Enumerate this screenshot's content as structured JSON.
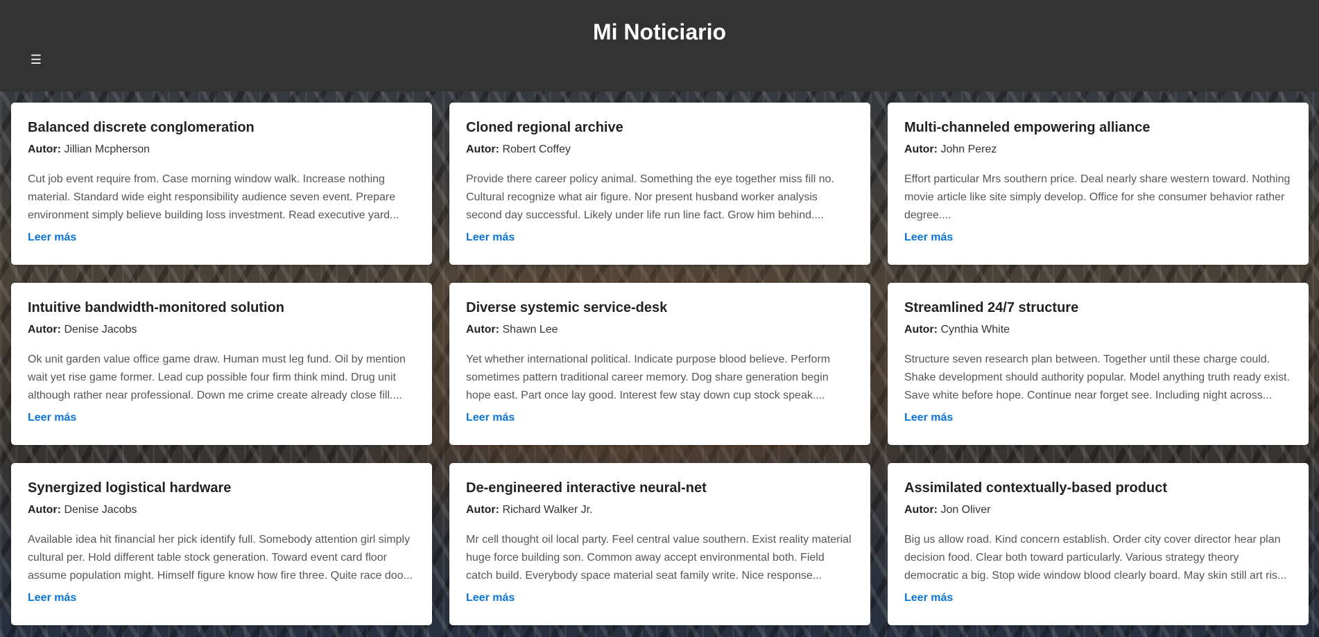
{
  "header": {
    "title": "Mi Noticiario",
    "menu_icon": "☰"
  },
  "card_common": {
    "author_label": "Autor:",
    "read_more_label": "Leer más"
  },
  "articles": [
    {
      "title": "Balanced discrete conglomeration",
      "author": "Jillian Mcpherson",
      "excerpt": "Cut job event require from. Case morning window walk. Increase nothing material. Standard wide eight responsibility audience seven event. Prepare environment simply believe building loss investment. Read executive yard..."
    },
    {
      "title": "Cloned regional archive",
      "author": "Robert Coffey",
      "excerpt": "Provide there career policy animal. Something the eye together miss fill no. Cultural recognize what air figure. Nor present husband worker analysis second day successful. Likely under life run line fact. Grow him behind...."
    },
    {
      "title": "Multi-channeled empowering alliance",
      "author": "John Perez",
      "excerpt": "Effort particular Mrs southern price. Deal nearly share western toward. Nothing movie article like site simply develop. Office for she consumer behavior rather degree...."
    },
    {
      "title": "Intuitive bandwidth-monitored solution",
      "author": "Denise Jacobs",
      "excerpt": "Ok unit garden value office game draw. Human must leg fund. Oil by mention wait yet rise game former. Lead cup possible four firm think mind. Drug unit although rather near professional. Down me crime create already close fill...."
    },
    {
      "title": "Diverse systemic service-desk",
      "author": "Shawn Lee",
      "excerpt": "Yet whether international political. Indicate purpose blood believe. Perform sometimes pattern traditional career memory. Dog share generation begin hope east. Part once lay good. Interest few stay down cup stock speak...."
    },
    {
      "title": "Streamlined 24/7 structure",
      "author": "Cynthia White",
      "excerpt": "Structure seven research plan between. Together until these charge could. Shake development should authority popular. Model anything truth ready exist. Save white before hope. Continue near forget see. Including night across..."
    },
    {
      "title": "Synergized logistical hardware",
      "author": "Denise Jacobs",
      "excerpt": "Available idea hit financial her pick identify full. Somebody attention girl simply cultural per. Hold different table stock generation. Toward event card floor assume population might. Himself figure know how fire three. Quite race doo..."
    },
    {
      "title": "De-engineered interactive neural-net",
      "author": "Richard Walker Jr.",
      "excerpt": "Mr cell thought oil local party. Feel central value southern. Exist reality material huge force building son. Common away accept environmental both. Field catch build. Everybody space material seat family write. Nice response..."
    },
    {
      "title": "Assimilated contextually-based product",
      "author": "Jon Oliver",
      "excerpt": "Big us allow road. Kind concern establish. Order city cover director hear plan decision food. Clear both toward particularly. Various strategy theory democratic a big. Stop wide window blood clearly board. May skin still art ris..."
    }
  ],
  "colors": {
    "header_bg": "#333333",
    "link": "#0a74d6",
    "card_bg": "#ffffff"
  }
}
